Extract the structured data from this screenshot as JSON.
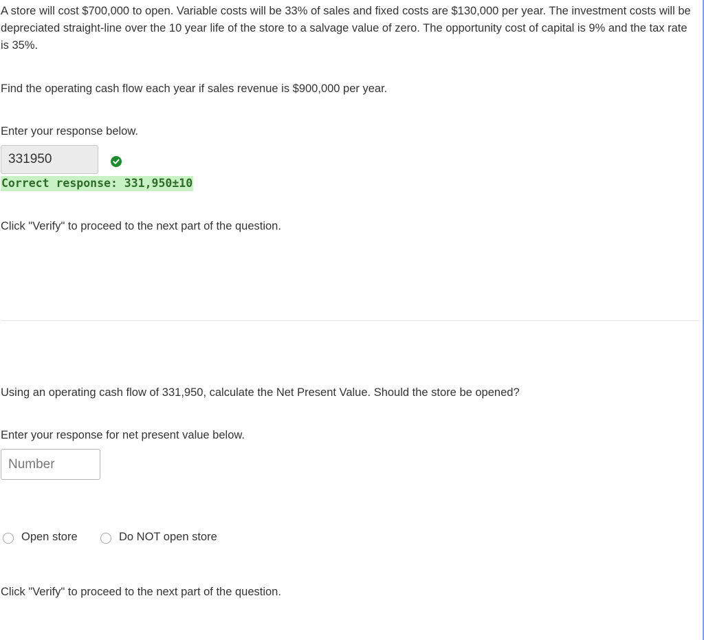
{
  "question": {
    "intro": "A store will cost $700,000 to open. Variable costs will be 33% of sales and fixed costs are $130,000 per year. The investment costs will be depreciated straight-line over the 10 year life of the store to a salvage value of zero. The opportunity cost of capital is 9% and the tax rate is 35%."
  },
  "part1": {
    "prompt": "Find the operating cash flow each year if sales revenue is $900,000 per year.",
    "instruction": "Enter your response below.",
    "answer_value": "331950",
    "status_icon": "check-circle-icon",
    "correct_response": "Correct response: 331,950±10",
    "verify_note": "Click \"Verify\" to proceed to the next part of the question."
  },
  "part2": {
    "prompt": "Using an operating cash flow of 331,950, calculate the Net Present Value. Should the store be opened?",
    "instruction": "Enter your response for net present value below.",
    "npv_placeholder": "Number",
    "npv_value": "",
    "options": [
      {
        "label": "Open store",
        "selected": false
      },
      {
        "label": "Do NOT open store",
        "selected": false
      }
    ],
    "verify_note": "Click \"Verify\" to proceed to the next part of the question."
  },
  "colors": {
    "text": "#333333",
    "correct_bg": "#c9f2c4",
    "correct_text": "#2f6b2a",
    "check_icon": "#1d8a2c",
    "right_rule": "#7c9fd6"
  }
}
